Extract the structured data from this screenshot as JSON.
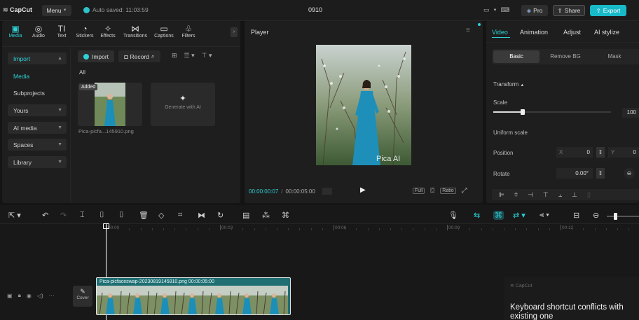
{
  "topbar": {
    "logo": "CapCut",
    "menu_label": "Menu",
    "autosave_text": "Auto saved: 11:03:59",
    "project_title": "0910",
    "pro_label": "Pro",
    "share_label": "Share",
    "export_label": "Export"
  },
  "media_tools": [
    {
      "icon": "media-icon",
      "glyph": "▣",
      "label": "Media"
    },
    {
      "icon": "audio-icon",
      "glyph": "◎",
      "label": "Audio"
    },
    {
      "icon": "text-icon",
      "glyph": "TI",
      "label": "Text"
    },
    {
      "icon": "stickers-icon",
      "glyph": "◔",
      "label": "Stickers"
    },
    {
      "icon": "effects-icon",
      "glyph": "✧",
      "label": "Effects"
    },
    {
      "icon": "transitions-icon",
      "glyph": "⋈",
      "label": "Transitions"
    },
    {
      "icon": "captions-icon",
      "glyph": "▭",
      "label": "Captions"
    },
    {
      "icon": "filters-icon",
      "glyph": "♧",
      "label": "Filters"
    }
  ],
  "sidebar": {
    "items": [
      {
        "label": "Import",
        "boxed": true,
        "active": true
      },
      {
        "label": "Media",
        "boxed": false,
        "active": true
      },
      {
        "label": "Subprojects",
        "boxed": false,
        "active": false
      },
      {
        "label": "Yours",
        "boxed": true,
        "active": false
      },
      {
        "label": "AI media",
        "boxed": true,
        "active": false
      },
      {
        "label": "Spaces",
        "boxed": true,
        "active": false
      },
      {
        "label": "Library",
        "boxed": true,
        "active": false
      }
    ]
  },
  "media": {
    "import_label": "Import",
    "record_label": "Record",
    "filter_all": "All",
    "added_badge": "Added",
    "file_name": "Pica-picfa...145910.png",
    "generate_label": "Generate with AI"
  },
  "player": {
    "title": "Player",
    "watermark": "Pica AI",
    "current_time": "00:00:00:07",
    "total_time": "00:00:05:00",
    "full_label": "Full",
    "ratio_label": "Ratio"
  },
  "props": {
    "tabs": [
      "Video",
      "Animation",
      "Adjust",
      "AI stylize"
    ],
    "subtabs": [
      "Basic",
      "Remove BG",
      "Mask"
    ],
    "transform_label": "Transform",
    "scale_label": "Scale",
    "scale_value": "100",
    "scale_fraction": 0.25,
    "uniform_label": "Uniform scale",
    "position_label": "Position",
    "pos_x_label": "X",
    "pos_x_value": "0",
    "pos_y_label": "Y",
    "pos_y_value": "0",
    "rotate_label": "Rotate",
    "rotate_value": "0.00°"
  },
  "timeline": {
    "ruler": [
      "00:00",
      "00:03",
      "00:06",
      "00:09",
      "00:12"
    ],
    "clip_label": "Pica-picfaceswap-20230819145910.png  00:00:05:00",
    "cover_label": "Cover"
  },
  "notice": {
    "brand": "CapCut",
    "text": "Keyboard shortcut conflicts with existing one"
  },
  "colors": {
    "accent": "#2fd0d6",
    "export_bg": "#18b9c8",
    "clip_bg": "#1f6f73"
  }
}
